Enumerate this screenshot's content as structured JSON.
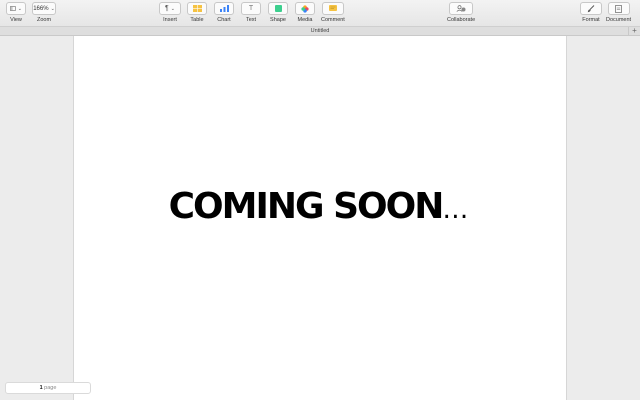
{
  "toolbar": {
    "view": {
      "label": "View",
      "icon": "sidebar-view-icon"
    },
    "zoom": {
      "label": "Zoom",
      "value": "166%"
    },
    "insert": {
      "label": "Insert",
      "icon": "pilcrow-icon"
    },
    "table": {
      "label": "Table",
      "icon": "table-icon"
    },
    "chart": {
      "label": "Chart",
      "icon": "chart-icon"
    },
    "text": {
      "label": "Text",
      "icon": "text-icon"
    },
    "shape": {
      "label": "Shape",
      "icon": "shape-icon"
    },
    "media": {
      "label": "Media",
      "icon": "media-icon"
    },
    "comment": {
      "label": "Comment",
      "icon": "comment-icon"
    },
    "collaborate": {
      "label": "Collaborate",
      "icon": "collaborate-icon"
    },
    "format": {
      "label": "Format",
      "icon": "paintbrush-icon"
    },
    "document": {
      "label": "Document",
      "icon": "document-icon"
    }
  },
  "window": {
    "title": "Untitled",
    "add_tab": "+"
  },
  "document": {
    "headline": "COMING SOON",
    "headline_suffix": "…"
  },
  "status": {
    "page_number": "1",
    "page_label": "page"
  },
  "colors": {
    "table": "#f5c242",
    "chart": "#3a82f7",
    "shape": "#3ccf8e",
    "comment": "#f5c242"
  }
}
